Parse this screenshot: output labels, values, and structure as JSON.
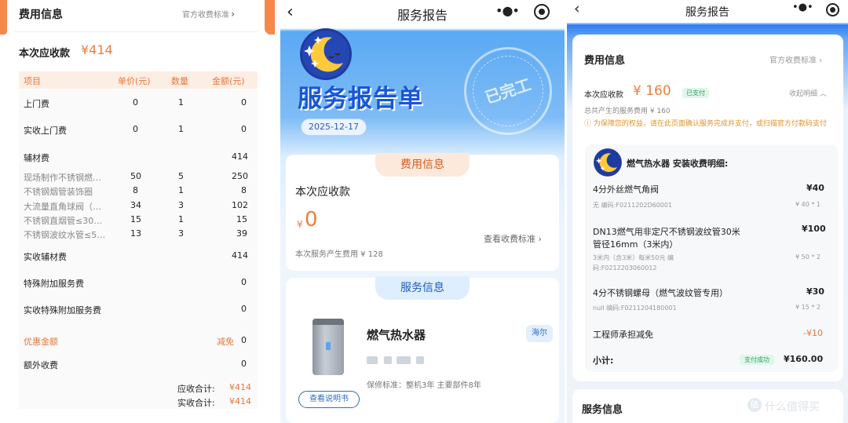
{
  "panel1": {
    "title": "费用信息",
    "official_fee_link": "官方收费标准",
    "amount_due_label": "本次应收款",
    "amount_due": "¥414",
    "table": {
      "headers": [
        "项目",
        "单价(元)",
        "数量",
        "金额(元)"
      ],
      "rows": [
        {
          "name": "上门费",
          "price": "0",
          "qty": "1",
          "amount": "0"
        },
        {
          "name": "实收上门费",
          "price": "0",
          "qty": "1",
          "amount": "0"
        },
        {
          "name": "辅材费",
          "price": "",
          "qty": "",
          "amount": "414"
        },
        {
          "name": "现场制作不锈钢燃…",
          "price": "50",
          "qty": "5",
          "amount": "250"
        },
        {
          "name": "不锈钢烟管装饰圈",
          "price": "8",
          "qty": "1",
          "amount": "8"
        },
        {
          "name": "大流量直角球阀（…",
          "price": "34",
          "qty": "3",
          "amount": "102"
        },
        {
          "name": "不锈钢直烟管≤30…",
          "price": "15",
          "qty": "1",
          "amount": "15"
        },
        {
          "name": "不锈钢波纹水管≤5…",
          "price": "13",
          "qty": "3",
          "amount": "39"
        },
        {
          "name": "实收辅材费",
          "price": "",
          "qty": "",
          "amount": "414"
        },
        {
          "name": "特殊附加服务费",
          "price": "",
          "qty": "",
          "amount": "0"
        },
        {
          "name": "实收特殊附加服务费",
          "price": "",
          "qty": "",
          "amount": "0"
        },
        {
          "name": "优惠金额",
          "price": "",
          "qty": "减免",
          "amount": "0"
        },
        {
          "name": "额外收费",
          "price": "",
          "qty": "",
          "amount": "0"
        }
      ],
      "total_due_label": "应收合计:",
      "total_due": "¥414",
      "total_received_label": "实收合计:",
      "total_received": "¥414"
    }
  },
  "panel2": {
    "back_icon": "‹",
    "title": "服务报告",
    "more_icon": "•●•",
    "big_title": "服务报告单",
    "date": "2025-12-17",
    "stamp_text": "已完工",
    "fee_tab": "费用信息",
    "amount_due_label": "本次应收款",
    "currency": "¥",
    "amount_due": "0",
    "view_fee_link": "查看收费标准",
    "service_fee_note": "本次服务产生费用 ¥ 128",
    "service_tab": "服务信息",
    "product_name": "燃气热水器",
    "brand_badge": "海尔",
    "warranty": "保修标准：整机3年 主要部件8年",
    "manual_button": "查看说明书"
  },
  "panel3": {
    "title": "服务报告",
    "fee_title": "费用信息",
    "official_fee_link": "官方收费标准 ›",
    "amount_due_label": "本次应收款",
    "amount_due": "¥ 160",
    "paid_badge": "已支付",
    "collapse_link": "收起明细 ︿",
    "total_fee_line": "总共产生的服务费用    ¥ 160",
    "notice": "ⓘ 为保障您的权益，请在此页面确认服务完成并支付，或扫描官方付款码支付",
    "detail_title": "燃气热水器 安装收费明细:",
    "items": [
      {
        "name": "4分外丝燃气角阀",
        "price": "¥40",
        "code": "无 编码:F0211202D60001",
        "unit": "¥ 40 * 1"
      },
      {
        "name_line1": "DN13燃气用非定尺不锈钢波纹管30米",
        "name_line2": "管径16mm（3米内）",
        "price": "¥100",
        "code_line1": "3米内（含3米）每米50元 编",
        "code_line2": "码:F0212203060012",
        "unit": "¥ 50 * 2"
      },
      {
        "name": "4分不锈钢螺母（燃气波纹管专用）",
        "price": "¥30",
        "code": "null 编码:F0211204180001",
        "unit": "¥ 15 * 2"
      }
    ],
    "engineer_discount_label": "工程师承担减免",
    "engineer_discount": "-¥10",
    "subtotal_label": "小计:",
    "paid_success_badge": "支付成功",
    "subtotal": "¥160.00",
    "service_info_title": "服务信息",
    "watermark_badge": "值",
    "watermark_text": "什么值得买"
  }
}
